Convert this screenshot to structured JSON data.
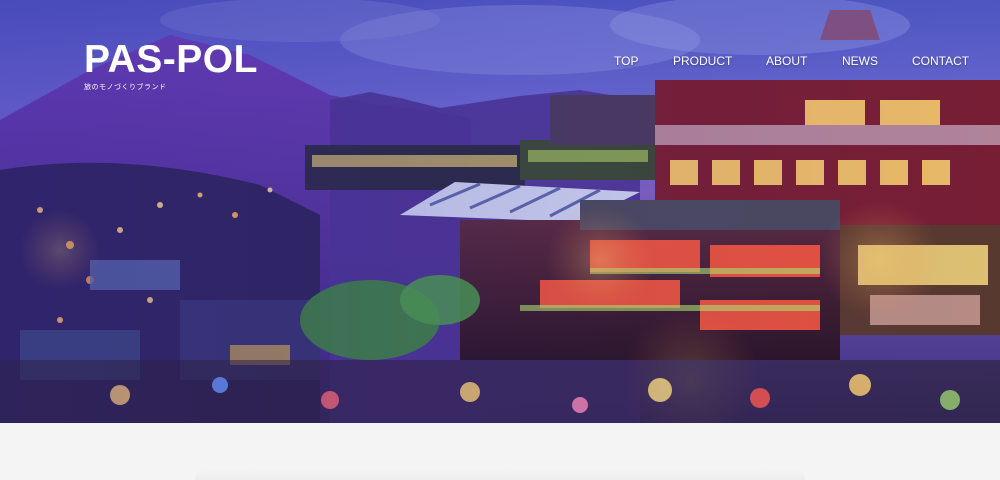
{
  "brand": {
    "logo": "PAS-POL",
    "tagline": "旅のモノづくりブランド"
  },
  "nav": {
    "items": [
      "TOP",
      "PRODUCT",
      "ABOUT",
      "NEWS",
      "CONTACT"
    ]
  },
  "colors": {
    "hero_tint": "#5b52b8",
    "page_background": "#f4f4f4",
    "nav_text": "#ffffff"
  },
  "hero": {
    "image_subject": "night-townscape-photo"
  }
}
